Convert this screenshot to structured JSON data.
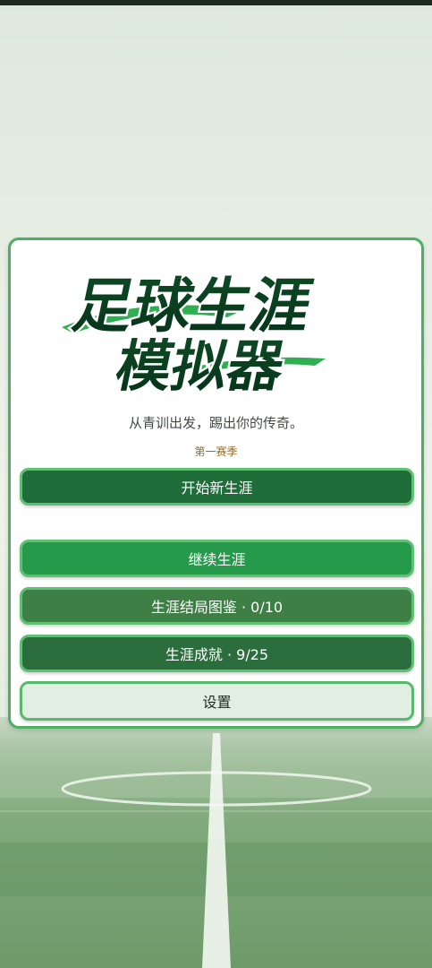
{
  "app": {
    "title_line1": "足球生涯",
    "title_line2": "模拟器",
    "subtitle": "从青训出发，踢出你的传奇。",
    "season": "第一赛季"
  },
  "menu": {
    "new_career": "开始新生涯",
    "continue_career": "继续生涯",
    "endings": "生涯结局图鉴 · 0/10",
    "achievements": "生涯成就 · 9/25",
    "settings": "设置"
  },
  "progress": {
    "endings_unlocked": 0,
    "endings_total": 10,
    "achievements_unlocked": 9,
    "achievements_total": 25
  },
  "colors": {
    "accent": "#4caf63",
    "button_dark": "#1f6e3a",
    "button_mid": "#259a4b",
    "season_text": "#9a6a1e"
  }
}
